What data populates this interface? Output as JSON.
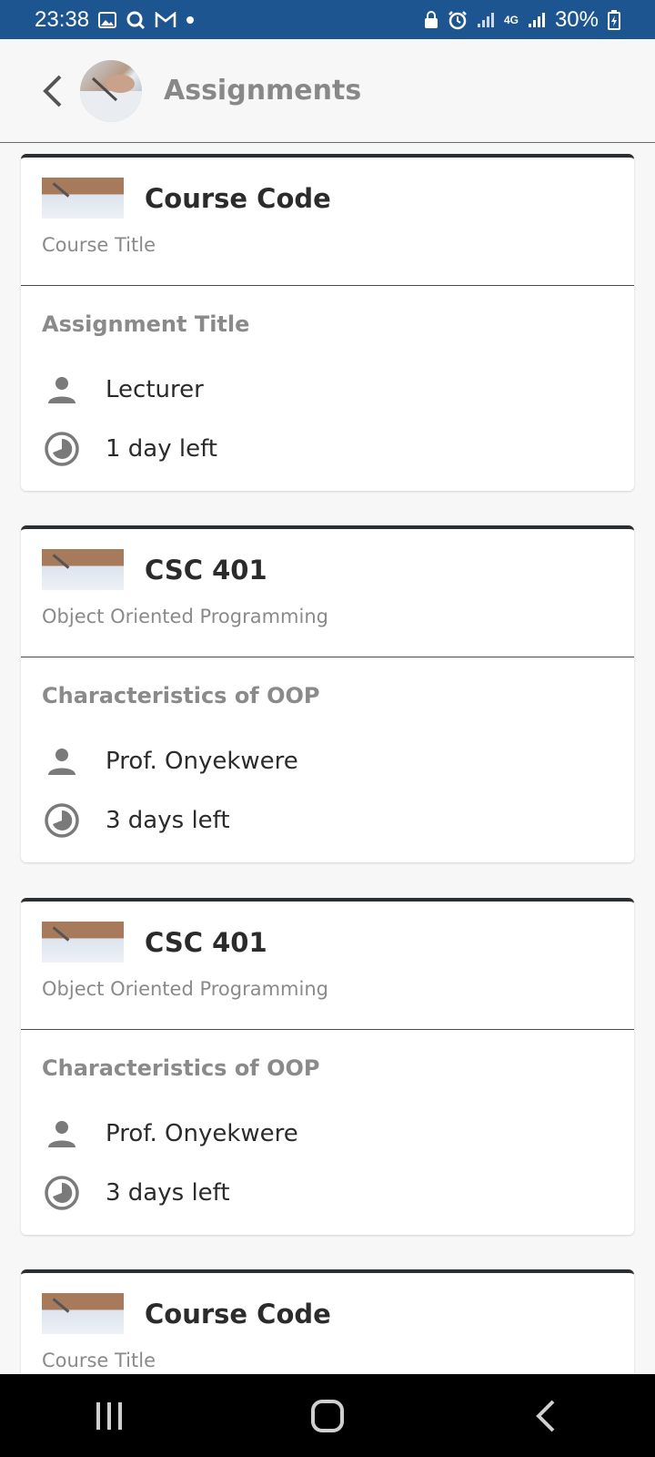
{
  "status_bar": {
    "time": "23:38",
    "battery": "30%",
    "network": "4G"
  },
  "header": {
    "title": "Assignments",
    "back_icon": "chevron-left-icon"
  },
  "assignments": [
    {
      "course_code": "Course Code",
      "course_title": "Course Title",
      "assignment_title": "Assignment Title",
      "lecturer": "Lecturer",
      "time_left": "1 day left"
    },
    {
      "course_code": "CSC 401",
      "course_title": "Object Oriented Programming",
      "assignment_title": "Characteristics of OOP",
      "lecturer": "Prof. Onyekwere",
      "time_left": "3 days left"
    },
    {
      "course_code": "CSC 401",
      "course_title": "Object Oriented Programming",
      "assignment_title": "Characteristics of OOP",
      "lecturer": "Prof. Onyekwere",
      "time_left": "3 days left"
    },
    {
      "course_code": "Course Code",
      "course_title": "Course Title"
    }
  ],
  "colors": {
    "status_bar": "#1d5590",
    "card_top_border": "#2b2f33",
    "muted_text": "#8a8a8a",
    "icon": "#7a7a7a"
  },
  "nav_bar": {
    "icons": [
      "recent-apps-icon",
      "home-icon",
      "back-icon"
    ]
  }
}
